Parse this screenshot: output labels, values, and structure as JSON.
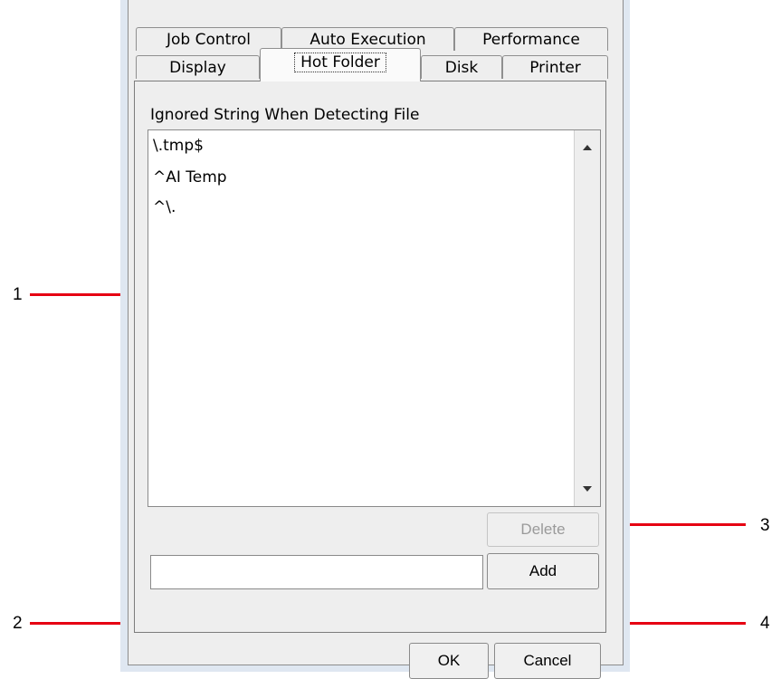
{
  "tabs_row1": [
    "Job Control",
    "Auto Execution",
    "Performance"
  ],
  "tabs_row2": [
    "Display",
    "Hot Folder",
    "Disk",
    "Printer"
  ],
  "active_tab": "Hot Folder",
  "panel": {
    "group_label": "Ignored String When Detecting File",
    "list_items": [
      "\\.tmp$",
      "^AI Temp",
      "^\\."
    ],
    "input_value": "",
    "delete_label": "Delete",
    "add_label": "Add"
  },
  "dialog": {
    "ok_label": "OK",
    "cancel_label": "Cancel"
  },
  "callouts": [
    "1",
    "2",
    "3",
    "4"
  ],
  "colors": {
    "callout_line": "#e60012",
    "window_frame": "#dfe7f1",
    "dialog_bg": "#eeeeee"
  }
}
